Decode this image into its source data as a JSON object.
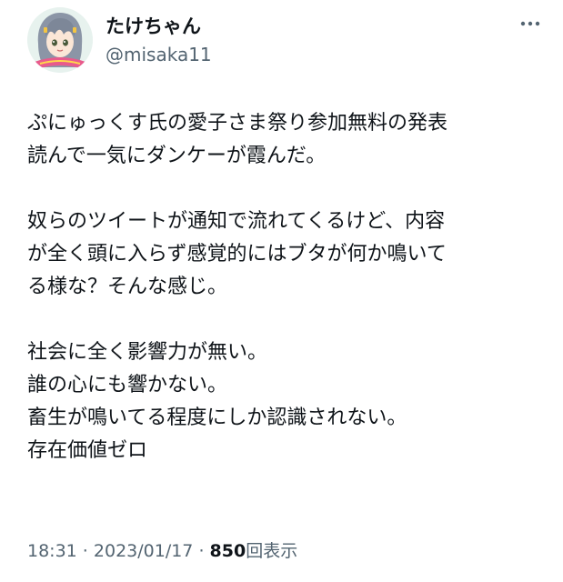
{
  "author": {
    "display_name": "たけちゃん",
    "handle": "@misaka11",
    "avatar_icon": "anime-girl-avatar"
  },
  "more_icon": "ellipsis-icon",
  "tweet": {
    "paragraphs": [
      [
        "ぷにゅっくす氏の愛子さま祭り参加無料の発表",
        "読んで一気にダンケーが霞んだ。"
      ],
      [
        "奴らのツイートが通知で流れてくるけど、内容",
        "が全く頭に入らず感覚的にはブタが何か鳴いて",
        "る様な？そんな感じ。"
      ],
      [
        "社会に全く影響力が無い。",
        "誰の心にも響かない。",
        "畜生が鳴いてる程度にしか認識されない。",
        "存在価値ゼロ"
      ]
    ]
  },
  "meta": {
    "time": "18:31",
    "separator": " · ",
    "date": "2023/01/17",
    "views_count": "850",
    "views_label": "回表示"
  },
  "colors": {
    "text": "#0f1419",
    "secondary": "#536471",
    "background": "#ffffff"
  }
}
